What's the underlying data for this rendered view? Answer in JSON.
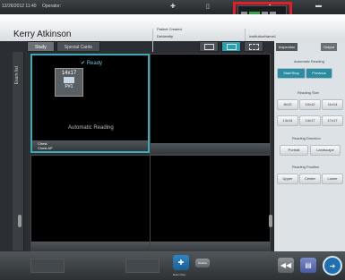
{
  "topbar": {
    "datetime": "12/26/2012 11:40",
    "operator_label": "Operator:",
    "icons": [
      "plus-icon",
      "document-icon",
      "square-icon",
      "menu-icon"
    ]
  },
  "header": {
    "patient_name": "Kerry Atkinson",
    "fields": [
      {
        "label": "Patient Created",
        "value": "DeIdentity"
      },
      {
        "label": "",
        "value": "InstitutionName1"
      }
    ]
  },
  "tabs": {
    "study": "Study",
    "special": "Special Cards"
  },
  "left_side": {
    "label": "Exam list"
  },
  "viewport1": {
    "status": "Ready",
    "cassette_size": "14x17",
    "plate": "P#1",
    "reading": "Automatic Reading",
    "footer_line1": "Chest",
    "footer_line2": "Chest AP"
  },
  "right_panel": {
    "tab_left": "Inspection",
    "tab_right": "Output",
    "title": "Automatic Reading",
    "mode_buttons": [
      "Start/Stop",
      "Previous"
    ],
    "reading_size_title": "Reading Size",
    "reading_sizes": [
      "8x10",
      "10x12",
      "11x14",
      "14x14",
      "14x17",
      "17x17"
    ],
    "reading_direction_title": "Reading Direction",
    "directions": [
      "Portrait",
      "Landscape"
    ],
    "reading_position_title": "Reading Position",
    "positions": [
      "Upper",
      "Center",
      "Lower"
    ]
  },
  "bottom_bar": {
    "add_label": "Exam Dup.",
    "info_label": "Studies"
  },
  "colors": {
    "accent": "#3aa9b8",
    "highlight": "#e21e26",
    "brand": "#1f6fb2"
  }
}
